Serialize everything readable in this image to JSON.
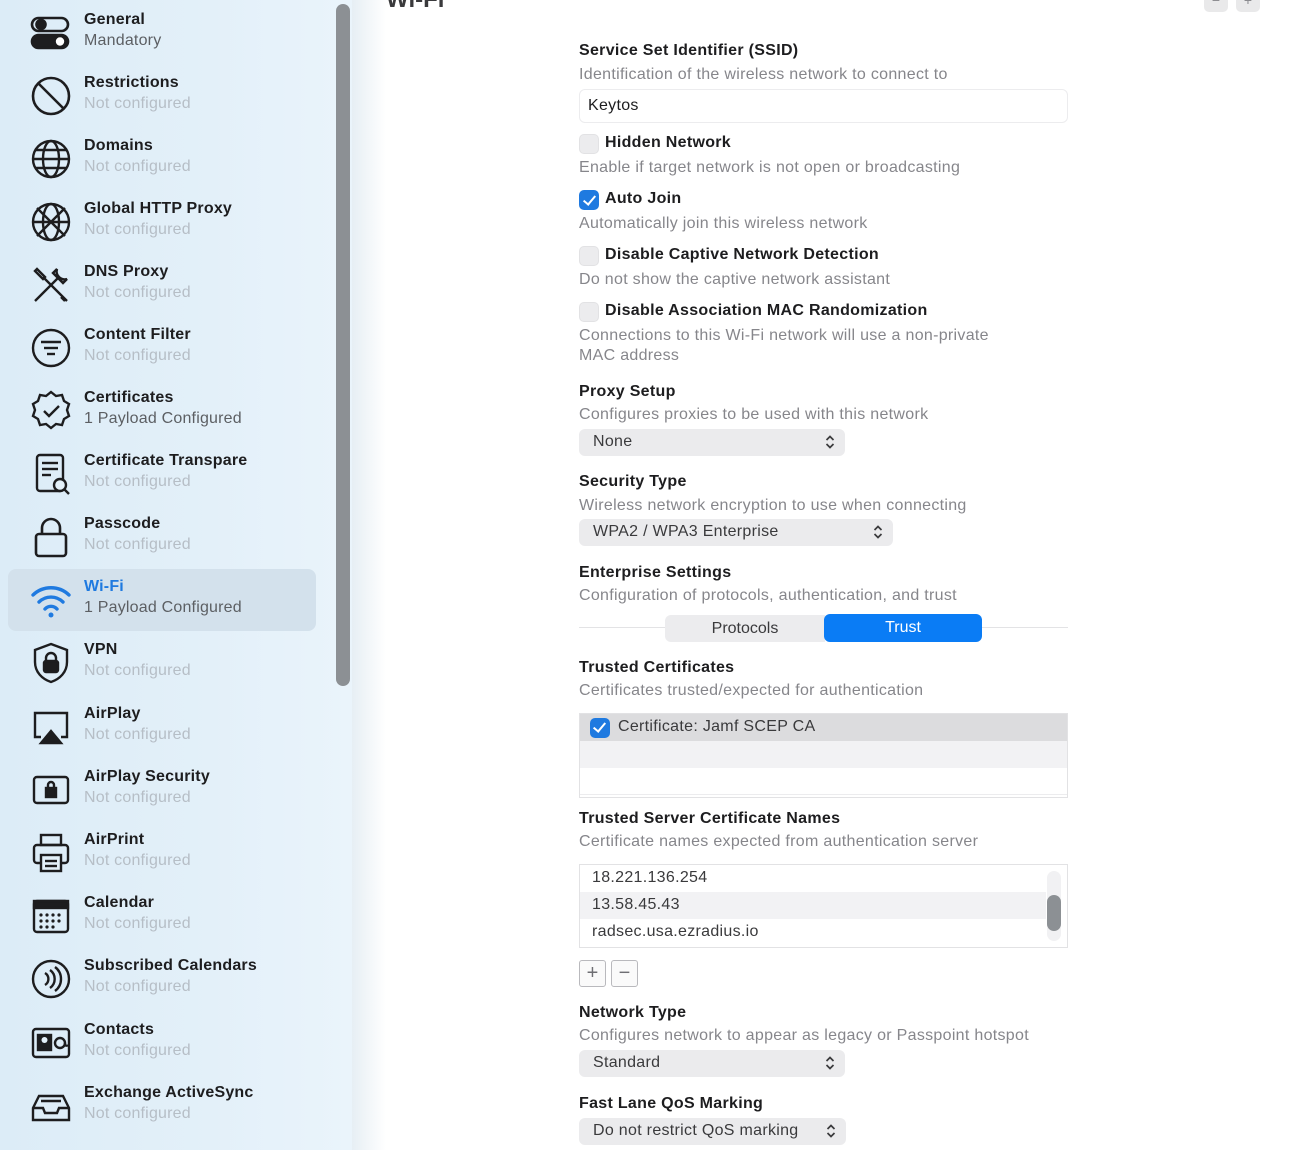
{
  "page": {
    "title": "Wi-Fi",
    "top_buttons": [
      "−",
      "+"
    ]
  },
  "sidebar": {
    "items": [
      {
        "name": "general",
        "title": "General",
        "subtitle": "Mandatory",
        "icon": "toggle-icon",
        "configured": true
      },
      {
        "name": "restrictions",
        "title": "Restrictions",
        "subtitle": "Not configured",
        "icon": "prohibited-icon",
        "configured": false
      },
      {
        "name": "domains",
        "title": "Domains",
        "subtitle": "Not configured",
        "icon": "globe-icon",
        "configured": false
      },
      {
        "name": "global-http-proxy",
        "title": "Global HTTP Proxy",
        "subtitle": "Not configured",
        "icon": "globe-network-icon",
        "configured": false
      },
      {
        "name": "dns-proxy",
        "title": "DNS Proxy",
        "subtitle": "Not configured",
        "icon": "tools-icon",
        "configured": false
      },
      {
        "name": "content-filter",
        "title": "Content Filter",
        "subtitle": "Not configured",
        "icon": "filter-icon",
        "configured": false
      },
      {
        "name": "certificates",
        "title": "Certificates",
        "subtitle": "1 Payload Configured",
        "icon": "certificate-seal-icon",
        "configured": true
      },
      {
        "name": "certificate-transparency",
        "title": "Certificate Transpare",
        "subtitle": "Not configured",
        "icon": "document-search-icon",
        "configured": false
      },
      {
        "name": "passcode",
        "title": "Passcode",
        "subtitle": "Not configured",
        "icon": "lock-icon",
        "configured": false
      },
      {
        "name": "wi-fi",
        "title": "Wi-Fi",
        "subtitle": "1 Payload Configured",
        "icon": "wifi-icon",
        "configured": true,
        "selected": true
      },
      {
        "name": "vpn",
        "title": "VPN",
        "subtitle": "Not configured",
        "icon": "shield-lock-icon",
        "configured": false
      },
      {
        "name": "airplay",
        "title": "AirPlay",
        "subtitle": "Not configured",
        "icon": "airplay-icon",
        "configured": false
      },
      {
        "name": "airplay-security",
        "title": "AirPlay Security",
        "subtitle": "Not configured",
        "icon": "screen-lock-icon",
        "configured": false
      },
      {
        "name": "airprint",
        "title": "AirPrint",
        "subtitle": "Not configured",
        "icon": "printer-icon",
        "configured": false
      },
      {
        "name": "calendar",
        "title": "Calendar",
        "subtitle": "Not configured",
        "icon": "calendar-icon",
        "configured": false
      },
      {
        "name": "subscribed-calendars",
        "title": "Subscribed Calendars",
        "subtitle": "Not configured",
        "icon": "broadcast-icon",
        "configured": false
      },
      {
        "name": "contacts",
        "title": "Contacts",
        "subtitle": "Not configured",
        "icon": "contact-card-icon",
        "configured": false
      },
      {
        "name": "exchange-activesync",
        "title": "Exchange ActiveSync",
        "subtitle": "Not configured",
        "icon": "inbox-tray-icon",
        "configured": false
      }
    ]
  },
  "ssid": {
    "title": "Service Set Identifier (SSID)",
    "description": "Identification of the wireless network to connect to",
    "value": "Keytos"
  },
  "hidden_network": {
    "label": "Hidden Network",
    "checked": false,
    "description": "Enable if target network is not open or broadcasting"
  },
  "auto_join": {
    "label": "Auto Join",
    "checked": true,
    "description": "Automatically join this wireless network"
  },
  "captive": {
    "label": "Disable Captive Network Detection",
    "checked": false,
    "description": "Do not show the captive network assistant"
  },
  "mac_random": {
    "label": "Disable Association MAC Randomization",
    "checked": false,
    "description_line1": "Connections to this Wi-Fi network will use a non-private",
    "description_line2": "MAC address"
  },
  "proxy": {
    "title": "Proxy Setup",
    "description": "Configures proxies to be used with this network",
    "value": "None"
  },
  "security": {
    "title": "Security Type",
    "description": "Wireless network encryption to use when connecting",
    "value": "WPA2 / WPA3 Enterprise"
  },
  "enterprise": {
    "title": "Enterprise Settings",
    "description": "Configuration of protocols, authentication, and trust",
    "tabs": [
      "Protocols",
      "Trust"
    ],
    "selected_tab": "Trust"
  },
  "trusted_certs": {
    "title": "Trusted Certificates",
    "description": "Certificates trusted/expected for authentication",
    "items": [
      {
        "label": "Certificate: Jamf SCEP CA",
        "checked": true
      }
    ]
  },
  "server_names": {
    "title": "Trusted Server Certificate Names",
    "description": "Certificate names expected from authentication server",
    "items": [
      "18.221.136.254",
      "13.58.45.43",
      "radsec.usa.ezradius.io"
    ],
    "add_label": "+",
    "remove_label": "−"
  },
  "network_type": {
    "title": "Network Type",
    "description": "Configures network to appear as legacy or Passpoint hotspot",
    "value": "Standard"
  },
  "qos": {
    "title": "Fast Lane QoS Marking",
    "value": "Do not restrict QoS marking"
  },
  "colors": {
    "accent": "#0a7cf5",
    "checkbox": "#1f7ae0",
    "sidebar_bg": "#e3f0f9",
    "muted_text": "#b6bec6"
  }
}
